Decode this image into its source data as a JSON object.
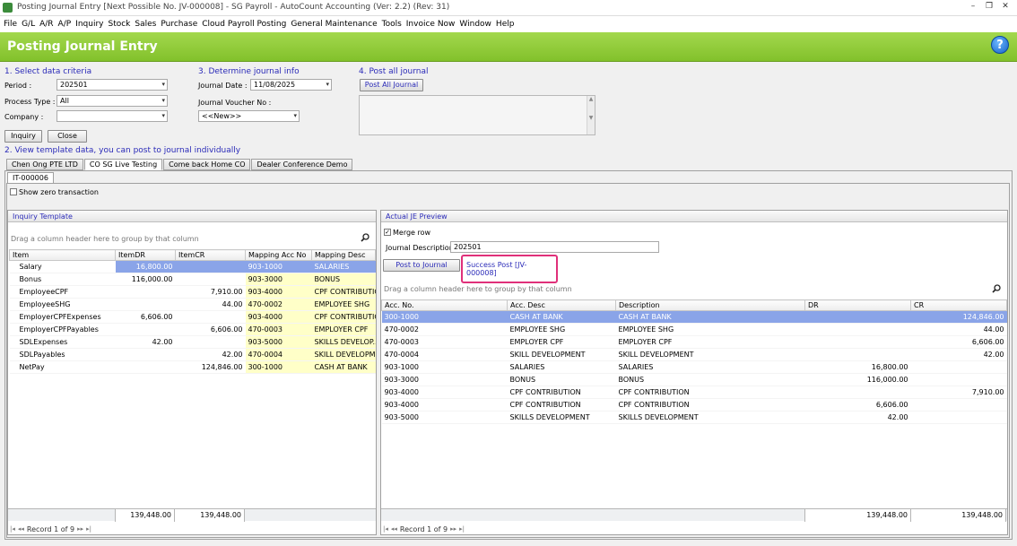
{
  "window": {
    "title": "Posting Journal Entry [Next Possible No. JV-000008] - SG Payroll - AutoCount Accounting (Ver: 2.2) (Rev: 31)"
  },
  "menu": [
    "File",
    "G/L",
    "A/R",
    "A/P",
    "Inquiry",
    "Stock",
    "Sales",
    "Purchase",
    "Cloud Payroll Posting",
    "General Maintenance",
    "Tools",
    "Invoice Now",
    "Window",
    "Help"
  ],
  "header": {
    "title": "Posting Journal Entry"
  },
  "criteria": {
    "section_label": "1. Select data criteria",
    "period_label": "Period :",
    "period_value": "202501",
    "process_label": "Process Type :",
    "process_value": "All",
    "company_label": "Company :",
    "company_value": "",
    "inquiry_btn": "Inquiry",
    "close_btn": "Close"
  },
  "journal_info": {
    "section_label": "3. Determine journal info",
    "date_label": "Journal Date :",
    "date_value": "11/08/2025",
    "voucher_label": "Journal Voucher No :",
    "voucher_value": "<<New>>"
  },
  "post_all": {
    "section_label": "4. Post all journal",
    "button": "Post All Journal"
  },
  "template_section": {
    "label": "2. View template data, you can post to journal individually",
    "tabs": [
      "Chen Ong PTE LTD",
      "CO SG Live Testing",
      "Come back Home CO",
      "Dealer Conference Demo"
    ],
    "subtab": "IT-000006",
    "show_zero": "Show zero transaction"
  },
  "inquiry": {
    "title": "Inquiry Template",
    "group_hint": "Drag a column header here to group by that column",
    "columns": [
      "Item",
      "ItemDR",
      "ItemCR",
      "Mapping Acc No",
      "Mapping Desc"
    ],
    "rows": [
      [
        "Salary",
        "16,800.00",
        "",
        "903-1000",
        "SALARIES"
      ],
      [
        "Bonus",
        "116,000.00",
        "",
        "903-3000",
        "BONUS"
      ],
      [
        "EmployeeCPF",
        "",
        "7,910.00",
        "903-4000",
        "CPF CONTRIBUTION"
      ],
      [
        "EmployeeSHG",
        "",
        "44.00",
        "470-0002",
        "EMPLOYEE SHG"
      ],
      [
        "EmployerCPFExpenses",
        "6,606.00",
        "",
        "903-4000",
        "CPF CONTRIBUTION"
      ],
      [
        "EmployerCPFPayables",
        "",
        "6,606.00",
        "470-0003",
        "EMPLOYER CPF"
      ],
      [
        "SDLExpenses",
        "42.00",
        "",
        "903-5000",
        "SKILLS DEVELOP..."
      ],
      [
        "SDLPayables",
        "",
        "42.00",
        "470-0004",
        "SKILL DEVELOPME..."
      ],
      [
        "NetPay",
        "",
        "124,846.00",
        "300-1000",
        "CASH AT BANK"
      ]
    ],
    "total_dr": "139,448.00",
    "total_cr": "139,448.00",
    "record": "Record 1 of 9"
  },
  "preview": {
    "title": "Actual JE Preview",
    "merge_label": "Merge row",
    "desc_label": "Journal Description :",
    "desc_value": "202501",
    "post_btn": "Post to Journal",
    "success": "Success Post [JV-000008]",
    "group_hint": "Drag a column header here to group by that column",
    "columns": [
      "Acc. No.",
      "Acc. Desc",
      "Description",
      "DR",
      "CR"
    ],
    "rows": [
      [
        "300-1000",
        "CASH AT BANK",
        "CASH AT BANK",
        "",
        "124,846.00"
      ],
      [
        "470-0002",
        "EMPLOYEE SHG",
        "EMPLOYEE SHG",
        "",
        "44.00"
      ],
      [
        "470-0003",
        "EMPLOYER CPF",
        "EMPLOYER CPF",
        "",
        "6,606.00"
      ],
      [
        "470-0004",
        "SKILL DEVELOPMENT",
        "SKILL DEVELOPMENT",
        "",
        "42.00"
      ],
      [
        "903-1000",
        "SALARIES",
        "SALARIES",
        "16,800.00",
        ""
      ],
      [
        "903-3000",
        "BONUS",
        "BONUS",
        "116,000.00",
        ""
      ],
      [
        "903-4000",
        "CPF CONTRIBUTION",
        "CPF CONTRIBUTION",
        "",
        "7,910.00"
      ],
      [
        "903-4000",
        "CPF CONTRIBUTION",
        "CPF CONTRIBUTION",
        "6,606.00",
        ""
      ],
      [
        "903-5000",
        "SKILLS DEVELOPMENT",
        "SKILLS DEVELOPMENT",
        "42.00",
        ""
      ]
    ],
    "total_dr": "139,448.00",
    "total_cr": "139,448.00",
    "record": "Record 1 of 9"
  }
}
